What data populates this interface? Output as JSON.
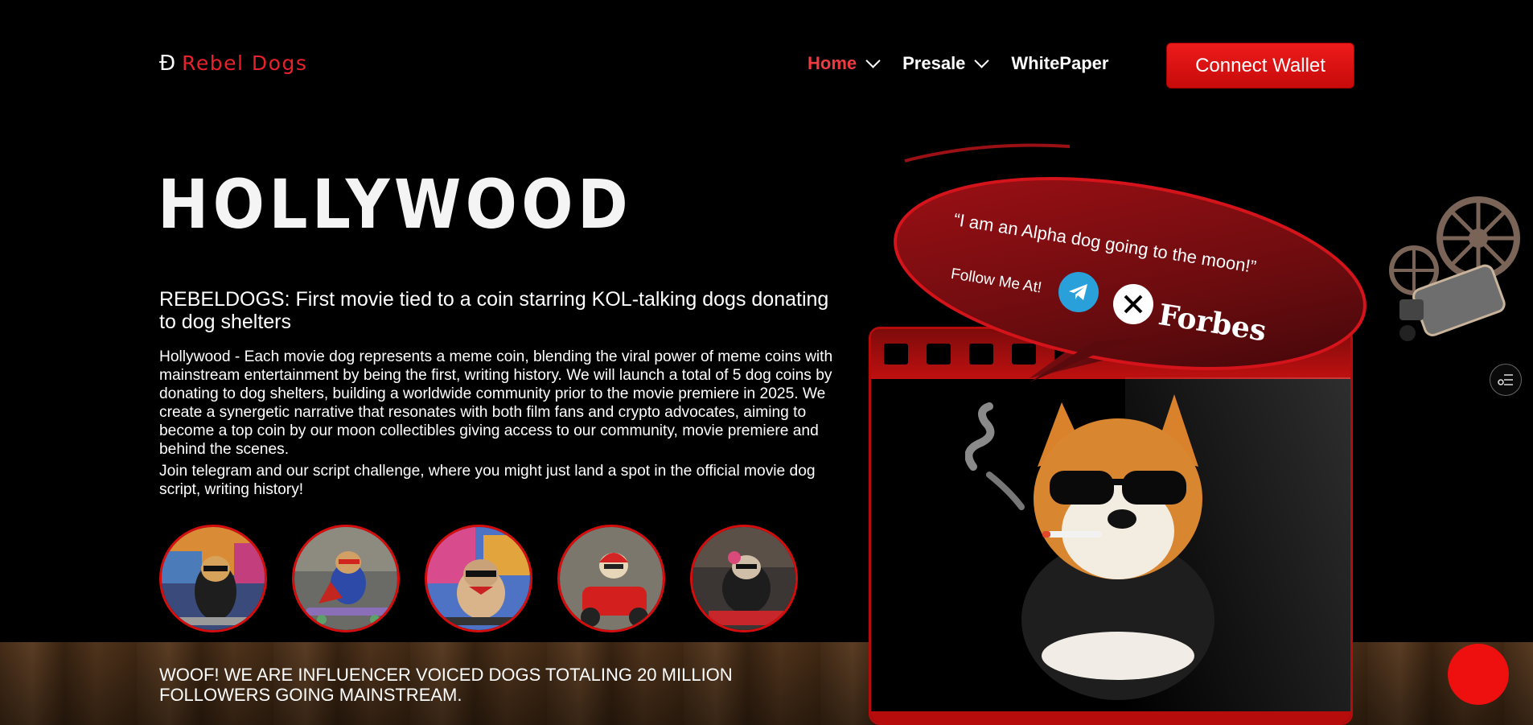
{
  "header": {
    "logo_mark": "Đ",
    "logo_text": "Rebel Dogs",
    "nav": [
      {
        "label": "Home",
        "has_dropdown": true,
        "active": true
      },
      {
        "label": "Presale",
        "has_dropdown": true,
        "active": false
      },
      {
        "label": "WhitePaper",
        "has_dropdown": false,
        "active": false
      }
    ],
    "connect_label": "Connect Wallet"
  },
  "hero": {
    "title": "HOLLYWOOD",
    "tagline": "REBELDOGS: First movie tied to a coin starring KOL-talking dogs donating to dog shelters",
    "description": "Hollywood - Each movie dog represents a meme coin, blending the viral power of meme coins with mainstream entertainment by being the first, writing history. We will launch a total of 5 dog coins by donating to dog shelters, building a worldwide community prior to the movie premiere in 2025. We create a synergetic narrative that resonates with both film fans and crypto advocates, aiming to become a top coin by our moon collectibles giving access to our community, movie premiere and behind the scenes.",
    "description2": "Join telegram and our script challenge, where you might just land a spot in the official movie dog script, writing history!",
    "avatars": [
      {
        "name": "dog-avatar-graffiti"
      },
      {
        "name": "dog-avatar-skateboard"
      },
      {
        "name": "dog-avatar-bulldog"
      },
      {
        "name": "dog-avatar-racer"
      },
      {
        "name": "dog-avatar-garage"
      }
    ]
  },
  "bubble": {
    "quote": "“I am an Alpha dog going to the moon!”",
    "follow_label": "Follow Me At!",
    "social": [
      "telegram-icon",
      "x-icon"
    ],
    "forbes_label": "Forbes"
  },
  "footer_banner": {
    "text": "WOOF! WE ARE INFLUENCER VOICED DOGS TOTALING 20 MILLION FOLLOWERS GOING MAINSTREAM."
  },
  "colors": {
    "accent": "#e8222a",
    "button": "#ee1b1b",
    "telegram": "#29a0da",
    "background": "#000000"
  }
}
